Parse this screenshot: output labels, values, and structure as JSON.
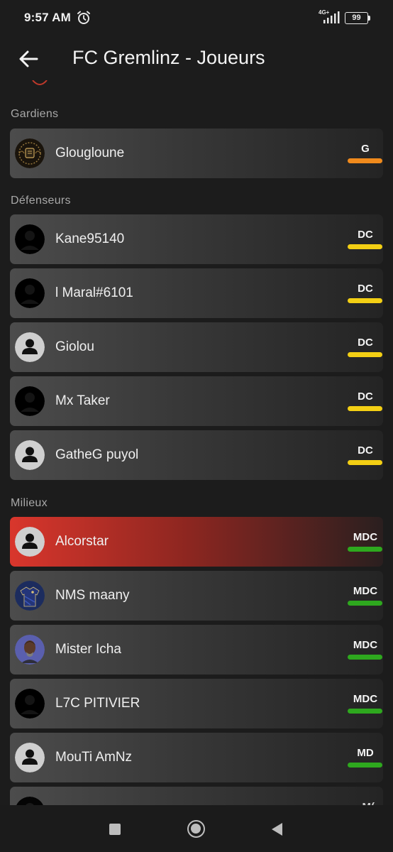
{
  "status_bar": {
    "time": "9:57 AM",
    "network": "4G+",
    "battery": "99",
    "icons": [
      "alarm-icon",
      "signal-icon",
      "battery-icon"
    ]
  },
  "app_bar": {
    "title": "FC Gremlinz - Joueurs",
    "back_icon": "arrow-left-icon"
  },
  "sections": {
    "goalkeepers": "Gardiens",
    "defenders": "Défenseurs",
    "midfielders": "Milieux"
  },
  "players": [
    {
      "name": "Glougloune",
      "position": "G",
      "color": "#f08a1c",
      "avatar": "crest"
    },
    {
      "name": "Kane95140",
      "position": "DC",
      "color": "#f3cf14",
      "avatar": "silhouette-dark"
    },
    {
      "name": "l Maral#6101",
      "position": "DC",
      "color": "#f3cf14",
      "avatar": "silhouette-dark"
    },
    {
      "name": "Giolou",
      "position": "DC",
      "color": "#f3cf14",
      "avatar": "default"
    },
    {
      "name": "Mx Taker",
      "position": "DC",
      "color": "#f3cf14",
      "avatar": "silhouette-dark"
    },
    {
      "name": "GatheG puyol",
      "position": "DC",
      "color": "#f3cf14",
      "avatar": "default"
    },
    {
      "name": "Alcorstar",
      "position": "MDC",
      "color": "#2ea81e",
      "avatar": "default",
      "selected": true
    },
    {
      "name": "NMS maany",
      "position": "MDC",
      "color": "#2ea81e",
      "avatar": "jersey"
    },
    {
      "name": "Mister Icha",
      "position": "MDC",
      "color": "#2ea81e",
      "avatar": "portrait"
    },
    {
      "name": "L7C PITIVIER",
      "position": "MDC",
      "color": "#2ea81e",
      "avatar": "silhouette-dark"
    },
    {
      "name": "MouTi AmNz",
      "position": "MD",
      "color": "#2ea81e",
      "avatar": "default"
    }
  ],
  "nav_bar": {
    "icons": [
      "recent-apps-icon",
      "home-icon",
      "back-triangle-icon"
    ]
  }
}
